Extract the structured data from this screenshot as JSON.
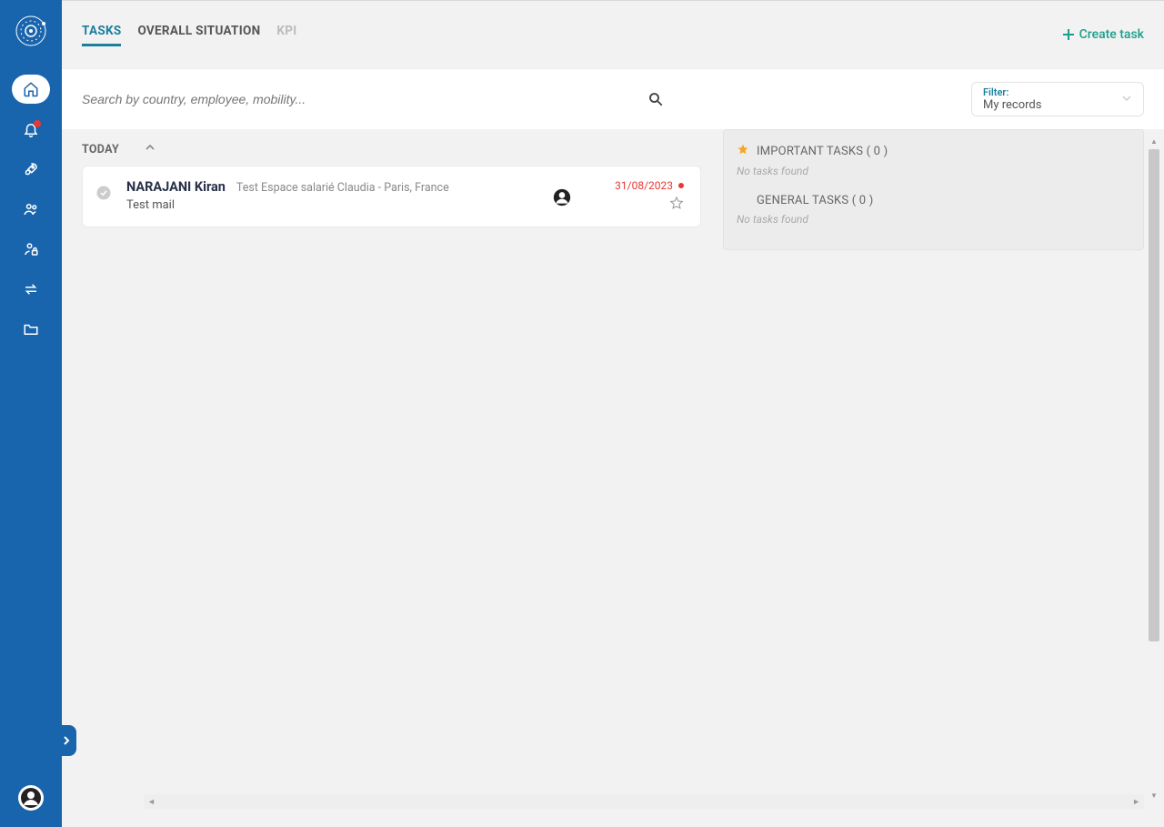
{
  "tabs": {
    "tasks": "TASKS",
    "overall": "OVERALL SITUATION",
    "kpi": "KPI"
  },
  "create_task_label": "Create task",
  "search": {
    "placeholder": "Search by country, employee, mobility..."
  },
  "filter": {
    "label": "Filter:",
    "value": "My records"
  },
  "today_label": "TODAY",
  "task": {
    "employee_name": "NARAJANI Kiran",
    "description": "Test Espace salarié Claudia - Paris, France",
    "subject": "Test mail",
    "date": "31/08/2023"
  },
  "right_panel": {
    "important_title": "IMPORTANT TASKS ( 0 )",
    "important_empty": "No tasks found",
    "general_title": "GENERAL TASKS ( 0 )",
    "general_empty": "No tasks found"
  }
}
